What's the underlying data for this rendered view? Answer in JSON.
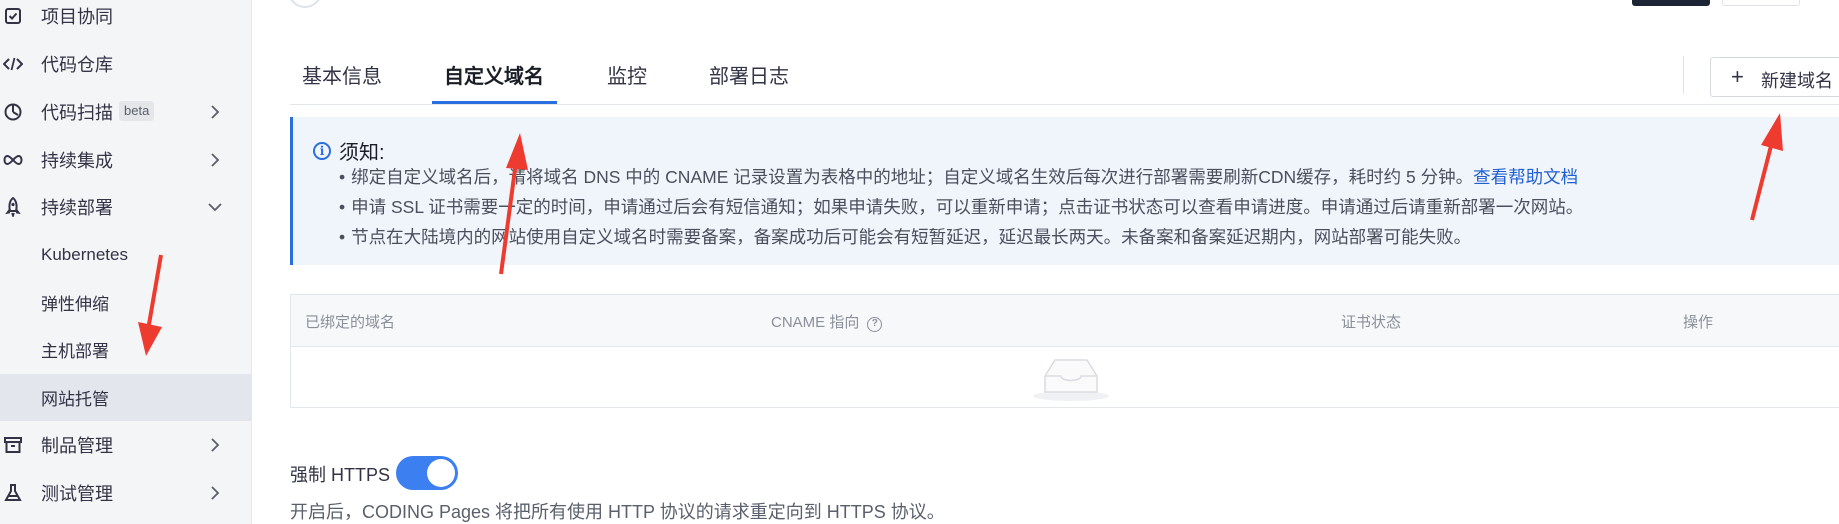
{
  "sidebar": {
    "items": [
      {
        "label": "项目协同",
        "icon": "checkbox-icon"
      },
      {
        "label": "代码仓库",
        "icon": "code-icon"
      },
      {
        "label": "代码扫描",
        "badge": "beta",
        "icon": "scan-icon"
      },
      {
        "label": "持续集成",
        "icon": "infinity-icon"
      },
      {
        "label": "持续部署",
        "icon": "rocket-icon"
      },
      {
        "label": "Kubernetes"
      },
      {
        "label": "弹性伸缩"
      },
      {
        "label": "主机部署"
      },
      {
        "label": "网站托管",
        "active": true
      },
      {
        "label": "制品管理",
        "icon": "package-icon"
      },
      {
        "label": "测试管理",
        "icon": "flask-icon"
      }
    ]
  },
  "tabs": [
    "基本信息",
    "自定义域名",
    "监控",
    "部署日志"
  ],
  "active_tab": "自定义域名",
  "new_domain_button": {
    "icon": "plus-icon",
    "label": "新建域名"
  },
  "notice": {
    "title": "须知:",
    "lines": [
      "绑定自定义域名后，请将域名 DNS 中的 CNAME 记录设置为表格中的地址；自定义域名生效后每次进行部署需要刷新CDN缓存，耗时约 5 分钟。",
      "申请 SSL 证书需要一定的时间，申请通过后会有短信通知；如果申请失败，可以重新申请；点击证书状态可以查看申请进度。申请通过后请重新部署一次网站。",
      "节点在大陆境内的网站使用自定义域名时需要备案，备案成功后可能会有短暂延迟，延迟最长两天。未备案和备案延迟期内，网站部署可能失败。"
    ],
    "help_link": "查看帮助文档"
  },
  "table": {
    "headers": [
      "已绑定的域名",
      "CNAME 指向",
      "证书状态",
      "操作"
    ]
  },
  "https": {
    "label": "强制 HTTPS",
    "enabled": true,
    "description": "开启后，CODING Pages 将把所有使用 HTTP 协议的请求重定向到 HTTPS 协议。"
  },
  "colors": {
    "accent": "#2a6fe0",
    "annotation": "#ee3b2f",
    "sidebar_bg": "#f4f5f7"
  }
}
